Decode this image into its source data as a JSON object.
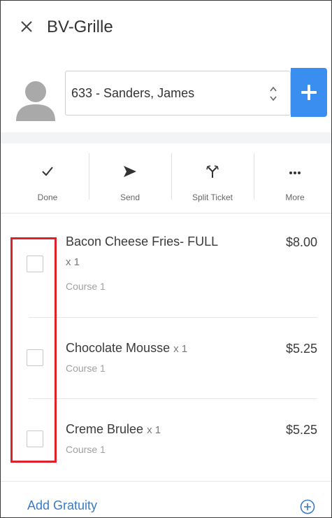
{
  "header": {
    "title": "BV-Grille",
    "close_icon": "close-icon"
  },
  "customer": {
    "avatar_icon": "user-avatar-icon",
    "selected": "633 - Sanders, James",
    "add_color": "#3a8ef0"
  },
  "toolbar": {
    "actions": [
      {
        "label": "Done",
        "icon": "checkmark-icon"
      },
      {
        "label": "Send",
        "icon": "send-icon"
      },
      {
        "label": "Split Ticket",
        "icon": "split-icon"
      },
      {
        "label": "More",
        "icon": "more-dots-icon"
      }
    ]
  },
  "items": [
    {
      "name": "Bacon Cheese Fries- FULL",
      "qty": "x 1",
      "course": "Course 1",
      "price": "$8.00"
    },
    {
      "name": "Chocolate Mousse",
      "qty": "x 1",
      "course": "Course 1",
      "price": "$5.25"
    },
    {
      "name": "Creme Brulee",
      "qty": "x 1",
      "course": "Course 1",
      "price": "$5.25"
    }
  ],
  "footer": {
    "gratuity_label": "Add Gratuity",
    "gratuity_icon": "add-circle-icon"
  },
  "colors": {
    "accent": "#3a8ef0",
    "link": "#3a7bc8",
    "highlight": "#e0202a"
  }
}
